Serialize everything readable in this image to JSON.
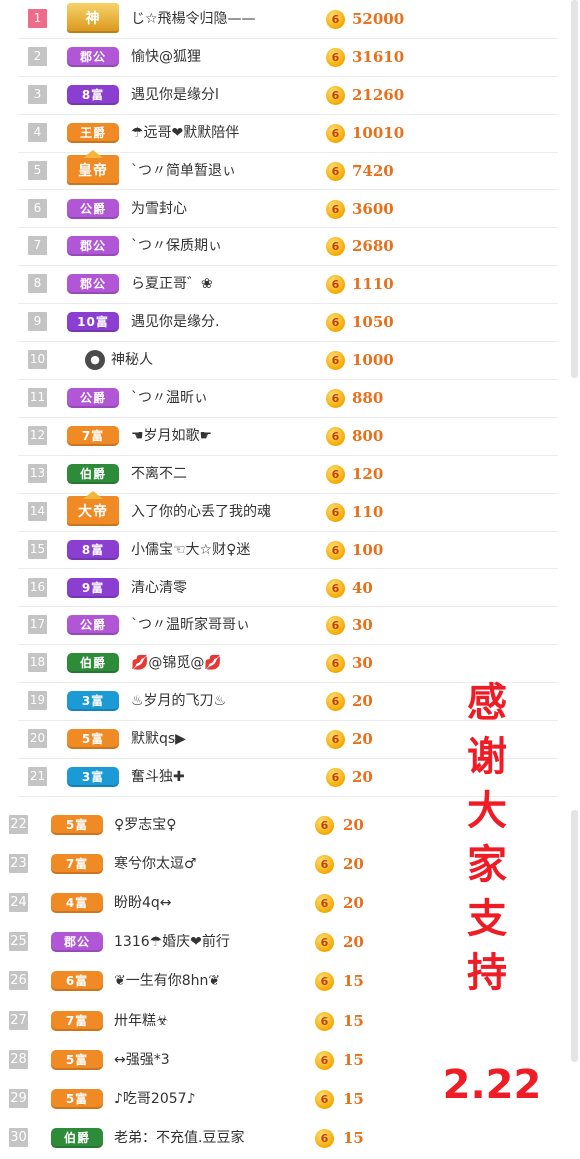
{
  "colors": {
    "amount": "#e8701a",
    "rank_top": "#ef6b8a",
    "rank_default": "#c4c4c4",
    "thanks_text": "#ef1c25",
    "badge_purple": "#8b3fd1",
    "badge_orange": "#f08a24",
    "badge_green": "#2e8b3a",
    "badge_blue": "#1b9ad6",
    "badge_violet": "#b157d6",
    "badge_gold": "#e5a117"
  },
  "coin_glyph": "6",
  "rows": [
    {
      "rank": "1",
      "badge": "神",
      "badge_color": "#e5a117",
      "nickname": "じ☆飛楊令归隐——",
      "amount": "52000"
    },
    {
      "rank": "2",
      "badge": "郡公",
      "badge_color": "#b157d6",
      "nickname": "愉快@狐狸",
      "amount": "31610"
    },
    {
      "rank": "3",
      "badge": "8富",
      "badge_color": "#8b3fd1",
      "nickname": "遇见你是缘分l",
      "amount": "21260"
    },
    {
      "rank": "4",
      "badge": "王爵",
      "badge_color": "#f08a24",
      "nickname": "☂远哥❤默默陪伴",
      "amount": "10010"
    },
    {
      "rank": "5",
      "badge": "皇帝",
      "badge_color": "#f08a24",
      "nickname": "ˋつ〃简单暂退ぃ",
      "amount": "7420"
    },
    {
      "rank": "6",
      "badge": "公爵",
      "badge_color": "#b157d6",
      "nickname": "为雪封心",
      "amount": "3600"
    },
    {
      "rank": "7",
      "badge": "郡公",
      "badge_color": "#b157d6",
      "nickname": "ˋつ〃保质期ぃ",
      "amount": "2680"
    },
    {
      "rank": "8",
      "badge": "郡公",
      "badge_color": "#b157d6",
      "nickname": "ら夏正哥゛❀",
      "amount": "1110"
    },
    {
      "rank": "9",
      "badge": "10富",
      "badge_color": "#8b3fd1",
      "nickname": "遇见你是缘分.",
      "amount": "1050"
    },
    {
      "rank": "10",
      "badge": "",
      "badge_color": "",
      "nickname": "神秘人",
      "amount": "1000"
    },
    {
      "rank": "11",
      "badge": "公爵",
      "badge_color": "#b157d6",
      "nickname": "ˋつ〃温昕ぃ",
      "amount": "880"
    },
    {
      "rank": "12",
      "badge": "7富",
      "badge_color": "#f08a24",
      "nickname": "☚岁月如歌☛",
      "amount": "800"
    },
    {
      "rank": "13",
      "badge": "伯爵",
      "badge_color": "#2e8b3a",
      "nickname": "不离不二",
      "amount": "120"
    },
    {
      "rank": "14",
      "badge": "大帝",
      "badge_color": "#f08a24",
      "nickname": "入了你的心丢了我的魂",
      "amount": "110"
    },
    {
      "rank": "15",
      "badge": "8富",
      "badge_color": "#8b3fd1",
      "nickname": "小儒宝☜大☆财♀迷",
      "amount": "100"
    },
    {
      "rank": "16",
      "badge": "9富",
      "badge_color": "#8b3fd1",
      "nickname": "清心清零",
      "amount": "40"
    },
    {
      "rank": "17",
      "badge": "公爵",
      "badge_color": "#b157d6",
      "nickname": "ˋつ〃温昕家哥哥ぃ",
      "amount": "30"
    },
    {
      "rank": "18",
      "badge": "伯爵",
      "badge_color": "#2e8b3a",
      "nickname": "💋@锦觅@💋",
      "amount": "30"
    },
    {
      "rank": "19",
      "badge": "3富",
      "badge_color": "#1b9ad6",
      "nickname": "♨岁月的飞刀♨",
      "amount": "20"
    },
    {
      "rank": "20",
      "badge": "5富",
      "badge_color": "#f08a24",
      "nickname": "默默qs▶",
      "amount": "20"
    },
    {
      "rank": "21",
      "badge": "3富",
      "badge_color": "#1b9ad6",
      "nickname": "奮斗独✚",
      "amount": "20"
    }
  ],
  "rows_b": [
    {
      "rank": "22",
      "badge": "5富",
      "badge_color": "#f08a24",
      "nickname": "♀罗志宝♀",
      "amount": "20"
    },
    {
      "rank": "23",
      "badge": "7富",
      "badge_color": "#f08a24",
      "nickname": "寒兮你太逗♂",
      "amount": "20"
    },
    {
      "rank": "24",
      "badge": "4富",
      "badge_color": "#f08a24",
      "nickname": "盼盼4q↔",
      "amount": "20"
    },
    {
      "rank": "25",
      "badge": "郡公",
      "badge_color": "#b157d6",
      "nickname": "1316☂婚庆❤前行",
      "amount": "20"
    },
    {
      "rank": "26",
      "badge": "6富",
      "badge_color": "#f08a24",
      "nickname": "❦一生有你8hn❦",
      "amount": "15"
    },
    {
      "rank": "27",
      "badge": "7富",
      "badge_color": "#f08a24",
      "nickname": "卅年糕☣",
      "amount": "15"
    },
    {
      "rank": "28",
      "badge": "5富",
      "badge_color": "#f08a24",
      "nickname": "↔强强*3",
      "amount": "15"
    },
    {
      "rank": "29",
      "badge": "5富",
      "badge_color": "#f08a24",
      "nickname": "♪吃哥2057♪",
      "amount": "15"
    },
    {
      "rank": "30",
      "badge": "伯爵",
      "badge_color": "#2e8b3a",
      "nickname": "老弟：不充值.豆豆家",
      "amount": "15"
    }
  ],
  "thanks": {
    "line1": "感",
    "line2": "谢",
    "line3": "大",
    "line4": "家",
    "line5": "支",
    "line6": "持",
    "date": "2.22"
  }
}
